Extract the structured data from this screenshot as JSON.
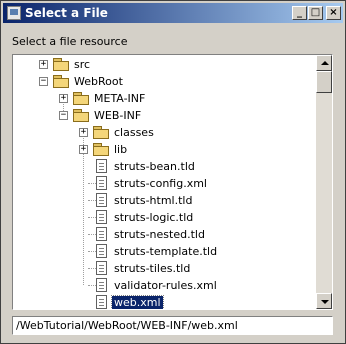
{
  "window": {
    "title": "Select a File"
  },
  "titlebar": {
    "minimize": "_",
    "maximize": "□",
    "close": "×"
  },
  "dialog": {
    "label": "Select a file resource"
  },
  "tree": {
    "items": [
      {
        "label": "src",
        "type": "folder",
        "expander": "+"
      },
      {
        "label": "WebRoot",
        "type": "folder",
        "expander": "−"
      },
      {
        "label": "META-INF",
        "type": "folder",
        "expander": "+"
      },
      {
        "label": "WEB-INF",
        "type": "folder",
        "expander": "−"
      },
      {
        "label": "classes",
        "type": "folder",
        "expander": "+"
      },
      {
        "label": "lib",
        "type": "folder",
        "expander": "+"
      },
      {
        "label": "struts-bean.tld",
        "type": "file"
      },
      {
        "label": "struts-config.xml",
        "type": "file"
      },
      {
        "label": "struts-html.tld",
        "type": "file"
      },
      {
        "label": "struts-logic.tld",
        "type": "file"
      },
      {
        "label": "struts-nested.tld",
        "type": "file"
      },
      {
        "label": "struts-template.tld",
        "type": "file"
      },
      {
        "label": "struts-tiles.tld",
        "type": "file"
      },
      {
        "label": "validator-rules.xml",
        "type": "file"
      },
      {
        "label": "web.xml",
        "type": "file",
        "selected": true
      }
    ]
  },
  "path": {
    "value": "/WebTutorial/WebRoot/WEB-INF/web.xml"
  },
  "colors": {
    "selection": "#0a246a",
    "titlebar_start": "#0a246a",
    "titlebar_end": "#a6caf0",
    "folder": "#f4d67a"
  }
}
